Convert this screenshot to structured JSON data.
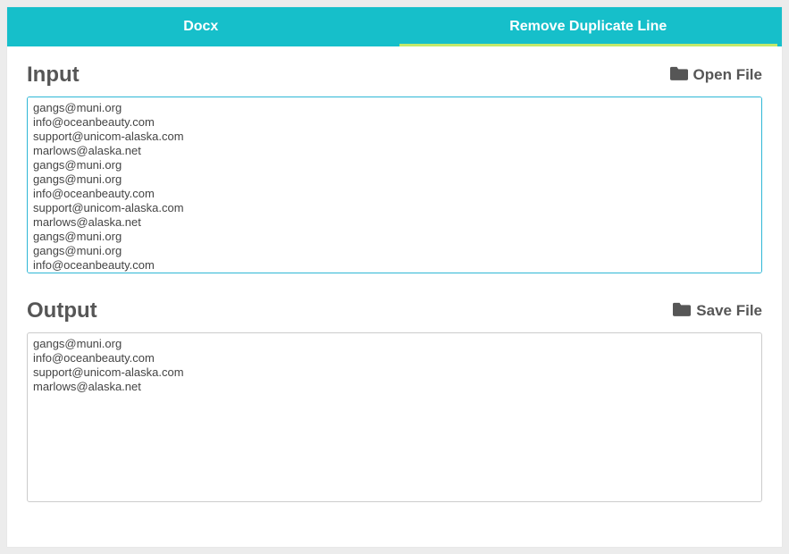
{
  "tabs": {
    "docx": "Docx",
    "remove_dup": "Remove Duplicate Line"
  },
  "input": {
    "title": "Input",
    "open_file": "Open File",
    "value": "gangs@muni.org\ninfo@oceanbeauty.com\nsupport@unicom-alaska.com\nmarlows@alaska.net\ngangs@muni.org\ngangs@muni.org\ninfo@oceanbeauty.com\nsupport@unicom-alaska.com\nmarlows@alaska.net\ngangs@muni.org\ngangs@muni.org\ninfo@oceanbeauty.com"
  },
  "output": {
    "title": "Output",
    "save_file": "Save File",
    "value": "gangs@muni.org\ninfo@oceanbeauty.com\nsupport@unicom-alaska.com\nmarlows@alaska.net"
  }
}
